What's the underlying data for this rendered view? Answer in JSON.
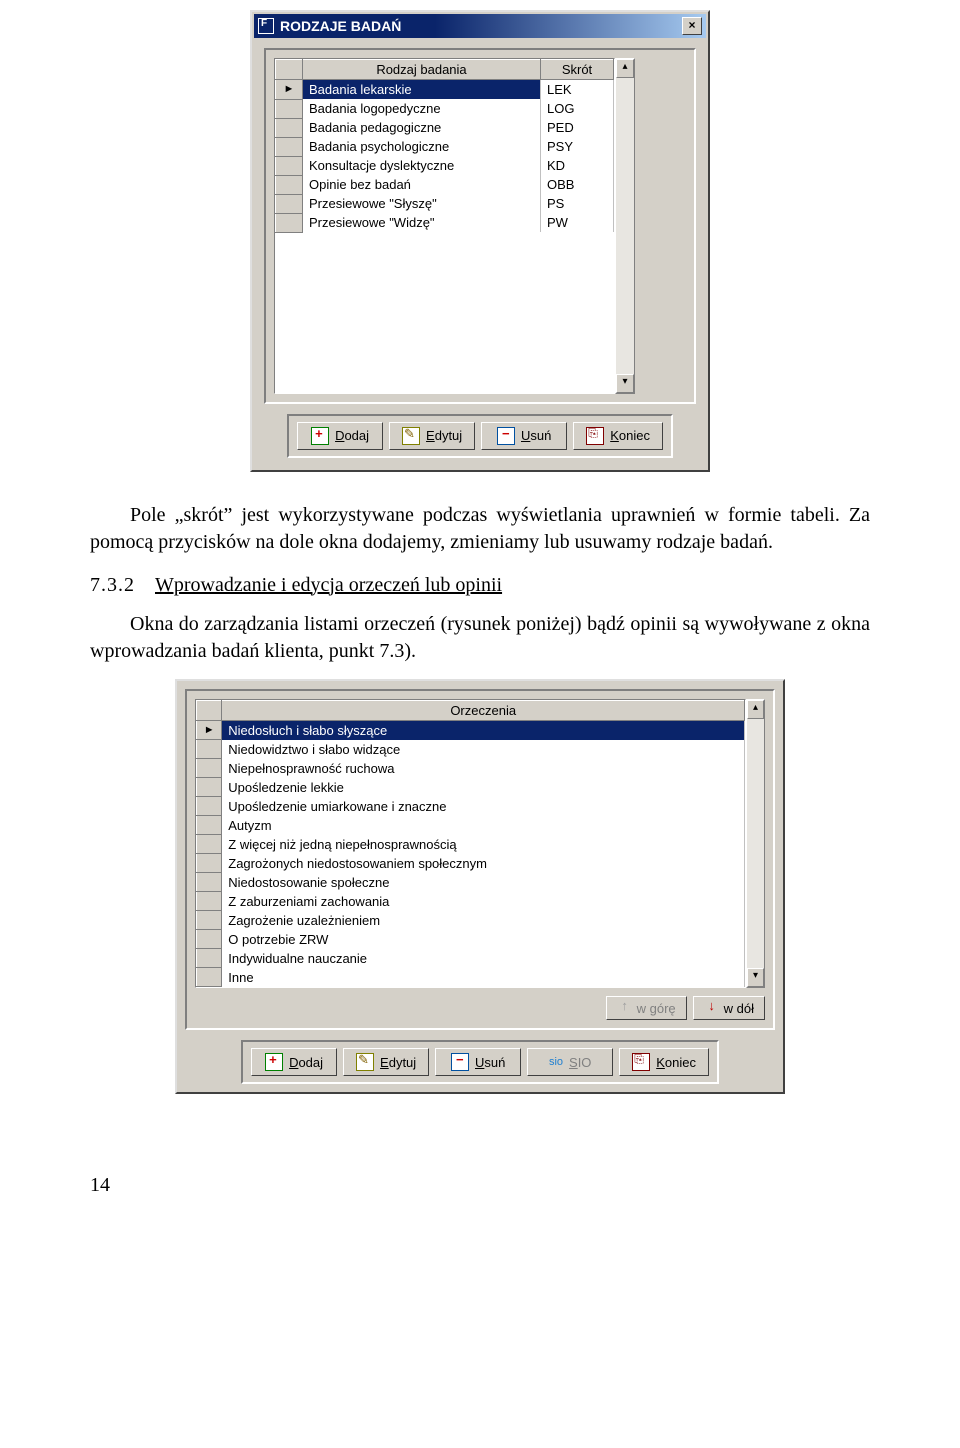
{
  "window1": {
    "title": "RODZAJE BADAŃ",
    "headers": {
      "col1": "Rodzaj badania",
      "col2": "Skrót"
    },
    "rows": [
      {
        "name": "Badania lekarskie",
        "abbr": "LEK",
        "selected": true,
        "marker": "►"
      },
      {
        "name": "Badania logopedyczne",
        "abbr": "LOG",
        "selected": false,
        "marker": ""
      },
      {
        "name": "Badania pedagogiczne",
        "abbr": "PED",
        "selected": false,
        "marker": ""
      },
      {
        "name": "Badania psychologiczne",
        "abbr": "PSY",
        "selected": false,
        "marker": ""
      },
      {
        "name": "Konsultacje dyslektyczne",
        "abbr": "KD",
        "selected": false,
        "marker": ""
      },
      {
        "name": "Opinie bez badań",
        "abbr": "OBB",
        "selected": false,
        "marker": ""
      },
      {
        "name": "Przesiewowe \"Słyszę\"",
        "abbr": "PS",
        "selected": false,
        "marker": ""
      },
      {
        "name": "Przesiewowe \"Widzę\"",
        "abbr": "PW",
        "selected": false,
        "marker": ""
      }
    ],
    "buttons": {
      "add": "Dodaj",
      "edit": "Edytuj",
      "del": "Usuń",
      "end": "Koniec"
    }
  },
  "paragraph1": "Pole „skrót” jest wykorzystywane podczas wyświetlania uprawnień w formie tabeli. Za pomocą przycisków na dole okna dodajemy, zmieniamy lub usuwamy rodzaje badań.",
  "heading": {
    "num": "7.3.2",
    "title": "Wprowadzanie i edycja orzeczeń lub opinii"
  },
  "paragraph2": "Okna do zarządzania listami orzeczeń (rysunek poniżej) bądź opinii są wywoływane z okna wprowadzania badań klienta,  punkt 7.3).",
  "window2": {
    "header": "Orzeczenia",
    "rows": [
      {
        "name": "Niedosłuch i słabo słyszące",
        "selected": true,
        "marker": "►"
      },
      {
        "name": "Niedowidztwo i słabo widzące",
        "selected": false,
        "marker": ""
      },
      {
        "name": "Niepełnosprawność ruchowa",
        "selected": false,
        "marker": ""
      },
      {
        "name": "Upośledzenie lekkie",
        "selected": false,
        "marker": ""
      },
      {
        "name": "Upośledzenie umiarkowane i znaczne",
        "selected": false,
        "marker": ""
      },
      {
        "name": "Autyzm",
        "selected": false,
        "marker": ""
      },
      {
        "name": "Z więcej niż jedną niepełnosprawnością",
        "selected": false,
        "marker": ""
      },
      {
        "name": "Zagrożonych niedostosowaniem społecznym",
        "selected": false,
        "marker": ""
      },
      {
        "name": "Niedostosowanie społeczne",
        "selected": false,
        "marker": ""
      },
      {
        "name": "Z zaburzeniami zachowania",
        "selected": false,
        "marker": ""
      },
      {
        "name": "Zagrożenie uzależnieniem",
        "selected": false,
        "marker": ""
      },
      {
        "name": "O potrzebie ZRW",
        "selected": false,
        "marker": ""
      },
      {
        "name": "Indywidualne nauczanie",
        "selected": false,
        "marker": ""
      },
      {
        "name": "Inne",
        "selected": false,
        "marker": ""
      }
    ],
    "updown": {
      "up": "w górę",
      "down": "w dół"
    },
    "buttons": {
      "add": "Dodaj",
      "edit": "Edytuj",
      "del": "Usuń",
      "sio": "SIO",
      "end": "Koniec"
    }
  },
  "page_number": "14"
}
